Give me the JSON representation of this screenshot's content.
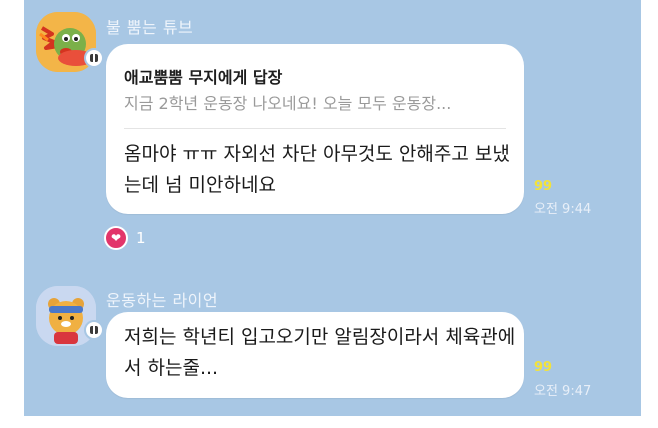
{
  "colors": {
    "chat_background": "#a8c7e4",
    "bubble": "#ffffff",
    "unread_count": "#f3e33a",
    "reaction_heart": "#e2356a"
  },
  "messages": [
    {
      "sender": "불 뿜는 튜브",
      "avatar_icon": "tube-character-avatar",
      "reply": {
        "title": "애교뿜뿜 무지에게 답장",
        "preview": "지금 2학년 운동장 나오네요! 오늘 모두 운동장..."
      },
      "text": "옴마야 ㅠㅠ 자외선 차단 아무것도 안해주고 보냈는데 넘 미안하네요",
      "unread": "99",
      "time": "오전 9:44",
      "reaction": {
        "icon": "heart-icon",
        "count": "1"
      }
    },
    {
      "sender": "운동하는 라이언",
      "avatar_icon": "ryan-character-avatar",
      "text": "저희는 학년티 입고오기만 알림장이라서 체육관에서 하는줄...",
      "unread": "99",
      "time": "오전 9:47"
    }
  ]
}
